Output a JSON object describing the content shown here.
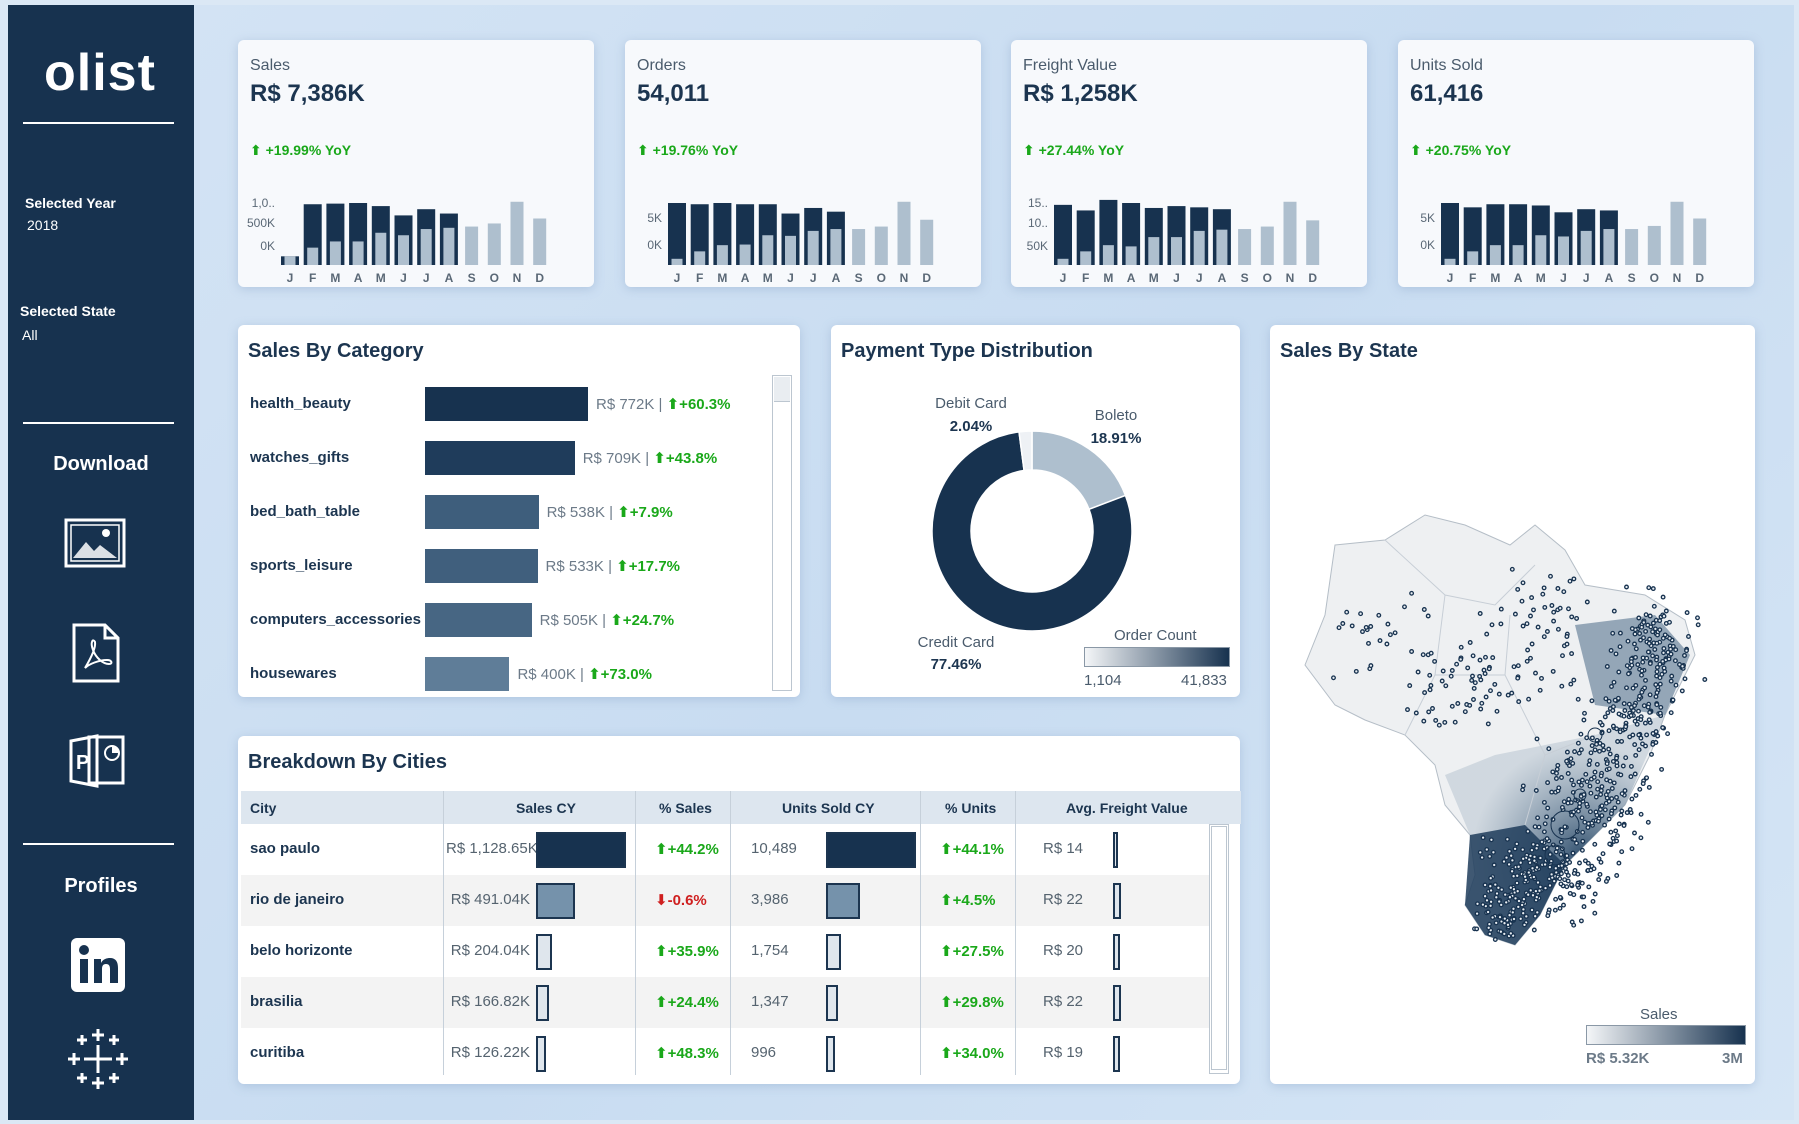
{
  "sidebar": {
    "logo": "olist",
    "selected_year_label": "Selected Year",
    "selected_year_value": "2018",
    "selected_state_label": "Selected State",
    "selected_state_value": "All",
    "download_label": "Download",
    "profiles_label": "Profiles",
    "download_icons": [
      "image-icon",
      "pdf-icon",
      "powerpoint-icon"
    ],
    "profile_icons": [
      "linkedin-icon",
      "tableau-icon"
    ]
  },
  "months": [
    "J",
    "F",
    "M",
    "A",
    "M",
    "J",
    "J",
    "A",
    "S",
    "O",
    "N",
    "D"
  ],
  "kpis": [
    {
      "title": "Sales",
      "value": "R$ 7,386K",
      "yoy": "⬆ +19.99% YoY",
      "ticks": [
        "1,0..",
        "500K",
        "0K"
      ],
      "chart_data": {
        "type": "bar",
        "current_year": [
          0.14,
          0.98,
          0.99,
          1.0,
          0.95,
          0.8,
          0.9,
          0.83,
          0,
          0,
          0,
          0
        ],
        "previous_year": [
          0.14,
          0.28,
          0.38,
          0.38,
          0.52,
          0.48,
          0.58,
          0.6,
          0.62,
          0.67,
          1.02,
          0.75
        ]
      }
    },
    {
      "title": "Orders",
      "value": "54,011",
      "yoy": "⬆ +19.76% YoY",
      "ticks": [
        "5K",
        "0K"
      ],
      "chart_data": {
        "type": "bar",
        "current_year": [
          1.0,
          0.98,
          1.0,
          0.98,
          0.98,
          0.83,
          0.92,
          0.86,
          0,
          0,
          0,
          0
        ],
        "previous_year": [
          0.1,
          0.22,
          0.32,
          0.33,
          0.48,
          0.47,
          0.55,
          0.58,
          0.58,
          0.62,
          1.02,
          0.73
        ]
      }
    },
    {
      "title": "Freight Value",
      "value": "R$ 1,258K",
      "yoy": "⬆ +27.44% YoY",
      "ticks": [
        "15..",
        "10..",
        "50K"
      ],
      "chart_data": {
        "type": "bar",
        "current_year": [
          0.97,
          0.88,
          1.05,
          1.0,
          0.92,
          0.95,
          0.93,
          0.9,
          0,
          0,
          0,
          0
        ],
        "previous_year": [
          0.1,
          0.22,
          0.32,
          0.3,
          0.45,
          0.45,
          0.55,
          0.57,
          0.58,
          0.62,
          1.02,
          0.72
        ]
      }
    },
    {
      "title": "Units Sold",
      "value": "61,416",
      "yoy": "⬆ +20.75% YoY",
      "ticks": [
        "5K",
        "0K"
      ],
      "chart_data": {
        "type": "bar",
        "current_year": [
          1.0,
          0.93,
          0.98,
          0.98,
          0.96,
          0.85,
          0.9,
          0.88,
          0,
          0,
          0,
          0
        ],
        "previous_year": [
          0.1,
          0.22,
          0.32,
          0.32,
          0.48,
          0.46,
          0.55,
          0.58,
          0.58,
          0.63,
          1.02,
          0.75
        ]
      }
    }
  ],
  "category": {
    "title": "Sales By Category",
    "items": [
      {
        "name": "health_beauty",
        "value": "R$ 772K",
        "change": "⬆+60.3%",
        "sales_k": 772,
        "color": "#17324f"
      },
      {
        "name": "watches_gifts",
        "value": "R$ 709K",
        "change": "⬆+43.8%",
        "sales_k": 709,
        "color": "#1f3c5b"
      },
      {
        "name": "bed_bath_table",
        "value": "R$ 538K",
        "change": "⬆+7.9%",
        "sales_k": 538,
        "color": "#3e5e7c"
      },
      {
        "name": "sports_leisure",
        "value": "R$ 533K",
        "change": "⬆+17.7%",
        "sales_k": 533,
        "color": "#405f7d"
      },
      {
        "name": "computers_accessories",
        "value": "R$ 505K",
        "change": "⬆+24.7%",
        "sales_k": 505,
        "color": "#476683"
      },
      {
        "name": "housewares",
        "value": "R$ 400K",
        "change": "⬆+73.0%",
        "sales_k": 400,
        "color": "#5f7d98"
      }
    ]
  },
  "payment": {
    "title": "Payment Type Distribution",
    "legend_title": "Order Count",
    "legend_min": "1,104",
    "legend_max": "41,833",
    "chart_data": {
      "type": "pie",
      "slices": [
        {
          "name": "Credit Card",
          "pct_label": "77.46%",
          "value": 77.46,
          "color": "#17324f"
        },
        {
          "name": "Debit Card",
          "pct_label": "2.04%",
          "value": 2.04,
          "color": "#eef1f5"
        },
        {
          "name": "Boleto",
          "pct_label": "18.91%",
          "value": 18.91,
          "color": "#aebfce"
        }
      ]
    }
  },
  "state": {
    "title": "Sales By State",
    "legend_title": "Sales",
    "legend_min": "R$ 5.32K",
    "legend_max": "3M"
  },
  "cities": {
    "title": "Breakdown By Cities",
    "headers": [
      "City",
      "Sales CY",
      "% Sales",
      "Units Sold CY",
      "% Units",
      "Avg. Freight Value"
    ],
    "rows": [
      {
        "city": "sao paulo",
        "sales": "R$ 1,128.65K",
        "sales_pct": "⬆+44.2%",
        "units": "10,489",
        "units_pct": "⬆+44.1%",
        "freight": "R$ 14",
        "sales_n": 1128.65,
        "units_n": 10489,
        "freight_n": 14,
        "sales_up": true
      },
      {
        "city": "rio de janeiro",
        "sales": "R$ 491.04K",
        "sales_pct": "⬇-0.6%",
        "units": "3,986",
        "units_pct": "⬆+4.5%",
        "freight": "R$ 22",
        "sales_n": 491.04,
        "units_n": 3986,
        "freight_n": 22,
        "sales_up": false
      },
      {
        "city": "belo horizonte",
        "sales": "R$ 204.04K",
        "sales_pct": "⬆+35.9%",
        "units": "1,754",
        "units_pct": "⬆+27.5%",
        "freight": "R$ 20",
        "sales_n": 204.04,
        "units_n": 1754,
        "freight_n": 20,
        "sales_up": true
      },
      {
        "city": "brasilia",
        "sales": "R$ 166.82K",
        "sales_pct": "⬆+24.4%",
        "units": "1,347",
        "units_pct": "⬆+29.8%",
        "freight": "R$ 22",
        "sales_n": 166.82,
        "units_n": 1347,
        "freight_n": 22,
        "sales_up": true
      },
      {
        "city": "curitiba",
        "sales": "R$ 126.22K",
        "sales_pct": "⬆+48.3%",
        "units": "996",
        "units_pct": "⬆+34.0%",
        "freight": "R$ 19",
        "sales_n": 126.22,
        "units_n": 996,
        "freight_n": 19,
        "sales_up": true
      }
    ]
  }
}
